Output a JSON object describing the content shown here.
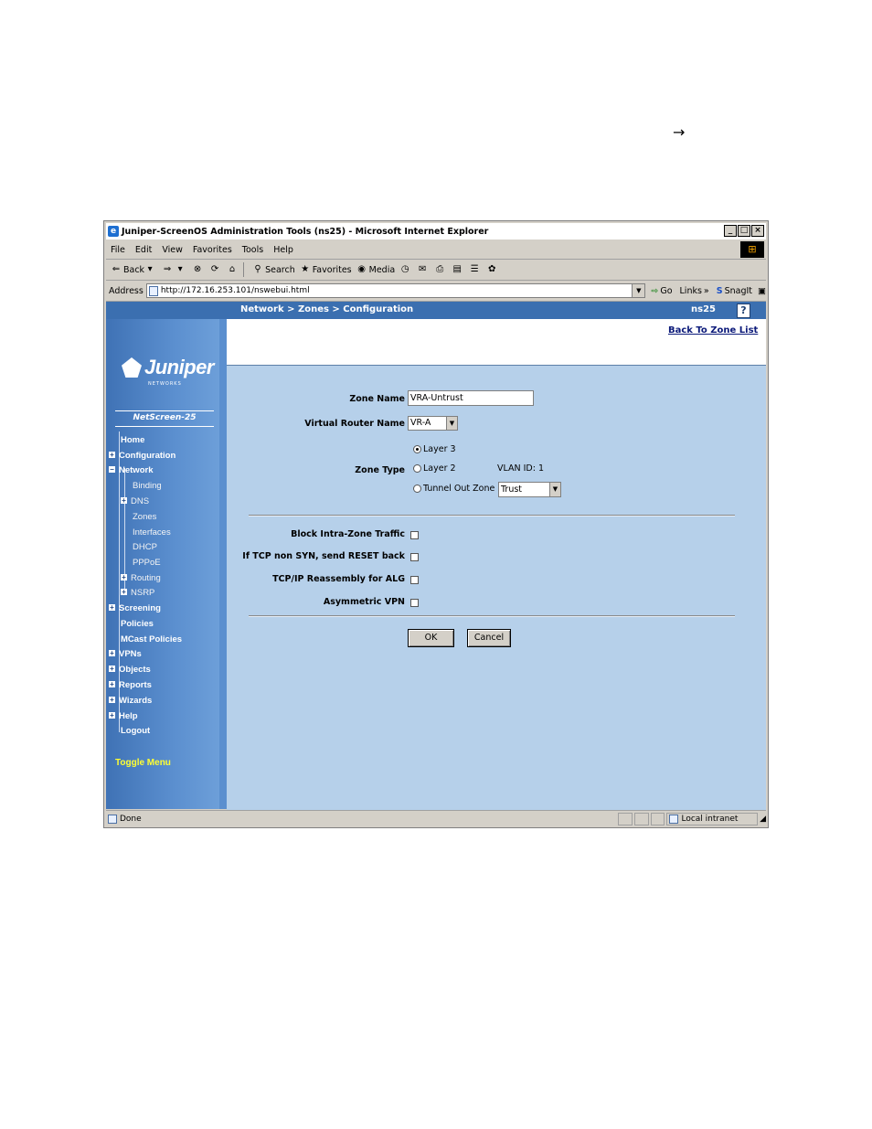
{
  "document": {
    "arrow_glyph": "→"
  },
  "window": {
    "title": "Juniper-ScreenOS Administration Tools (ns25) - Microsoft Internet Explorer",
    "controls": {
      "minimize": "_",
      "maximize": "□",
      "close": "×"
    }
  },
  "menu": [
    "File",
    "Edit",
    "View",
    "Favorites",
    "Tools",
    "Help"
  ],
  "toolbar": {
    "back": "Back",
    "search": "Search",
    "favorites": "Favorites",
    "media": "Media"
  },
  "address": {
    "label": "Address",
    "url": "http://172.16.253.101/nswebui.html",
    "go": "Go",
    "links": "Links",
    "snagit": "SnagIt"
  },
  "header": {
    "breadcrumb": "Network > Zones > Configuration",
    "device": "ns25",
    "help": "?"
  },
  "sidebar": {
    "logo": "Juniper",
    "logo_sub": "NETWORKS",
    "model": "NetScreen-25",
    "items": [
      {
        "label": "Home"
      },
      {
        "label": "Configuration"
      },
      {
        "label": "Network"
      },
      {
        "label": "Binding"
      },
      {
        "label": "DNS"
      },
      {
        "label": "Zones"
      },
      {
        "label": "Interfaces"
      },
      {
        "label": "DHCP"
      },
      {
        "label": "PPPoE"
      },
      {
        "label": "Routing"
      },
      {
        "label": "NSRP"
      },
      {
        "label": "Screening"
      },
      {
        "label": "Policies"
      },
      {
        "label": "MCast Policies"
      },
      {
        "label": "VPNs"
      },
      {
        "label": "Objects"
      },
      {
        "label": "Reports"
      },
      {
        "label": "Wizards"
      },
      {
        "label": "Help"
      },
      {
        "label": "Logout"
      }
    ],
    "toggle": "Toggle Menu"
  },
  "page": {
    "back_link": "Back To Zone List",
    "zone_name_label": "Zone Name",
    "zone_name_value": "VRA-Untrust",
    "vr_label": "Virtual Router Name",
    "vr_value": "VR-A",
    "zone_type_label": "Zone Type",
    "layer3": "Layer 3",
    "layer2": "Layer 2",
    "vlan_id": "VLAN ID: 1",
    "tunnel_out": "Tunnel Out Zone",
    "tunnel_zone_value": "Trust",
    "block_intra": "Block Intra-Zone Traffic",
    "tcp_reset": "If TCP non SYN, send RESET back",
    "tcp_reassembly": "TCP/IP Reassembly for ALG",
    "asym_vpn": "Asymmetric VPN",
    "ok": "OK",
    "cancel": "Cancel"
  },
  "status": {
    "text": "Done",
    "zone": "Local intranet"
  }
}
